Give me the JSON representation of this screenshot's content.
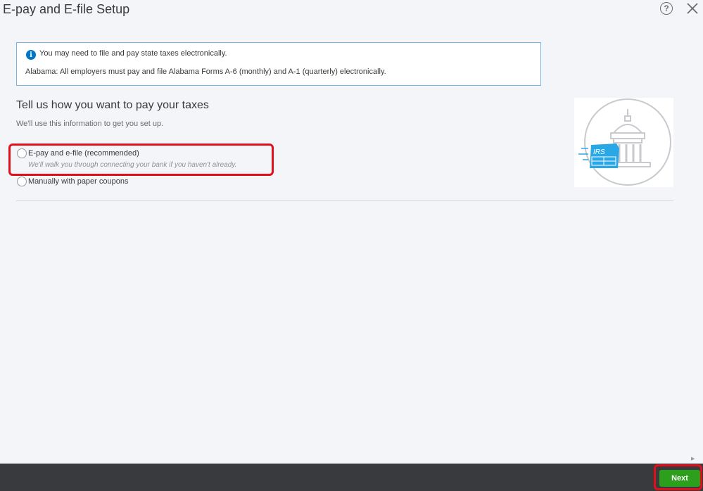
{
  "dialog": {
    "title": "E-pay and E-file Setup",
    "help_icon": "question-circle-icon",
    "help_glyph": "?",
    "close_icon": "close-x-icon"
  },
  "info_box": {
    "icon": "info-icon",
    "icon_glyph": "i",
    "message": "You may need to file and pay state taxes electronically.",
    "detail": "Alabama: All employers must pay and file Alabama Forms A-6 (monthly) and A-1 (quarterly) electronically."
  },
  "section": {
    "title": "Tell us how you want to pay your taxes",
    "subtitle": "We'll use this information to get you set up."
  },
  "options": [
    {
      "label": "E-pay and e-file (recommended)",
      "sublabel": "We'll walk you through connecting your bank if you haven't already.",
      "selected": false,
      "highlighted": true
    },
    {
      "label": "Manually with paper coupons",
      "selected": false
    }
  ],
  "illustration": {
    "icon": "government-building-irs-form-icon",
    "badge_text": "IRS"
  },
  "footer": {
    "next_label": "Next",
    "next_highlighted": true
  },
  "colors": {
    "accent_green": "#2ca01c",
    "info_blue": "#0077c5",
    "highlight_red": "#e0101b",
    "footer_bg": "#393a3d",
    "irs_blue": "#2aa8e6"
  }
}
